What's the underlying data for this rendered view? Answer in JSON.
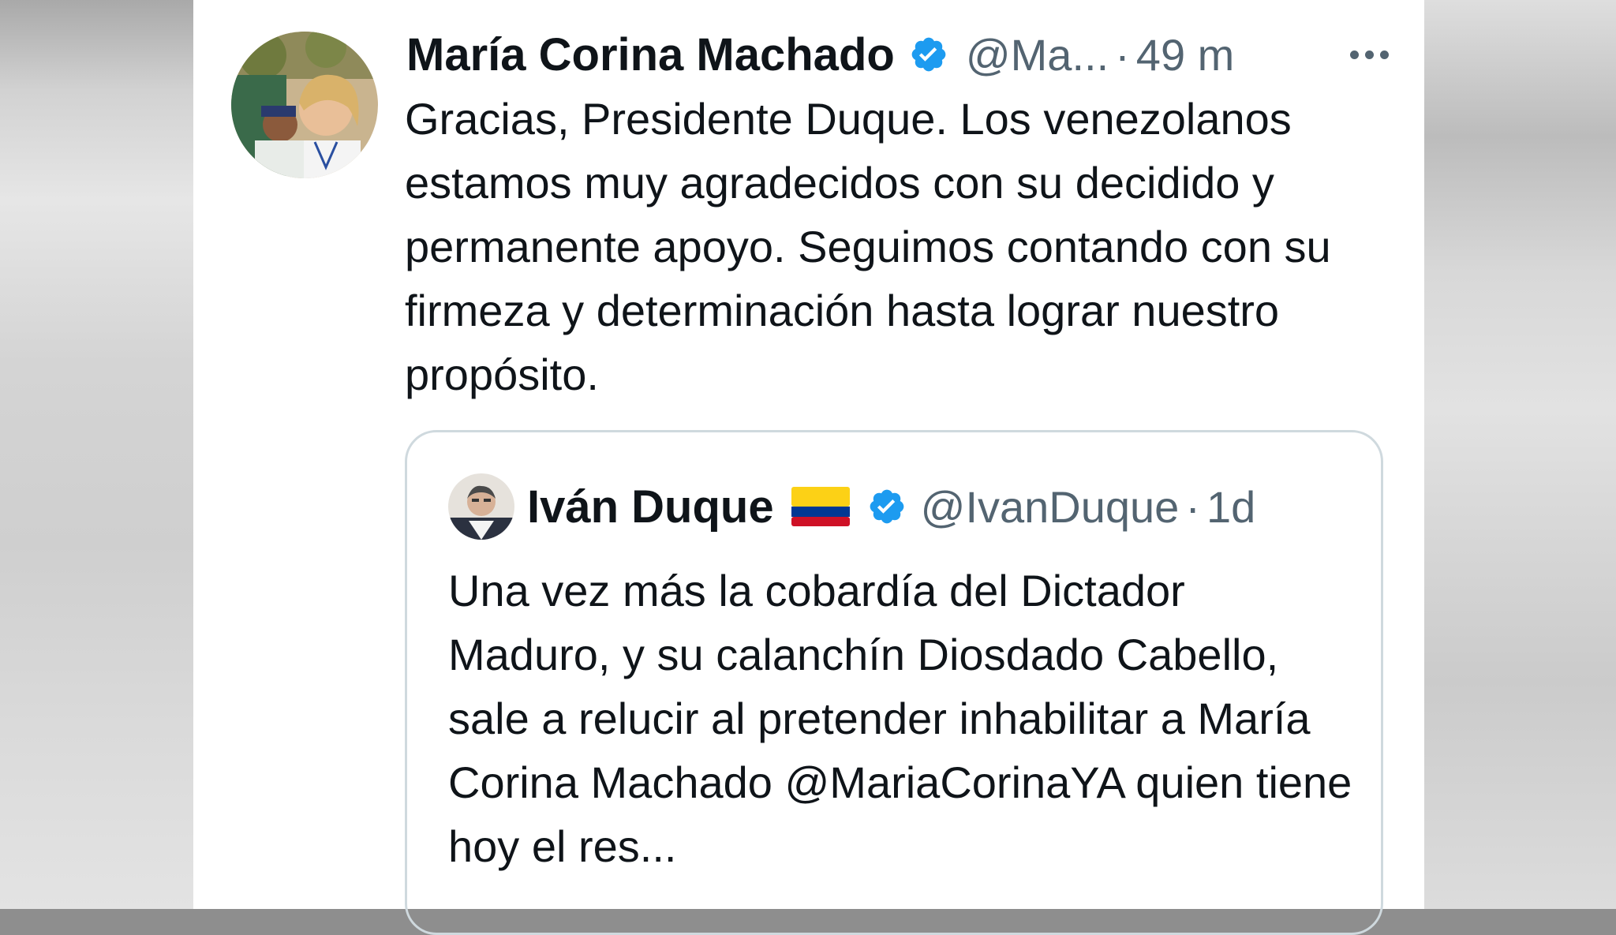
{
  "tweet": {
    "author_name": "María Corina Machado",
    "handle": "@Ma...",
    "separator": "·",
    "time": "49 m",
    "verified_icon": "verified-badge-icon",
    "more_icon": "more-options-icon",
    "text": "Gracias, Presidente Duque. Los venezolanos estamos muy agradecidos con su decidido y permanente apoyo. Seguimos contando con su firmeza y determinación hasta lograr nuestro propósito."
  },
  "quoted_tweet": {
    "author_name": "Iván Duque",
    "flag_icon": "colombia-flag-icon",
    "verified_icon": "verified-badge-icon",
    "handle": "@IvanDuque",
    "separator": "·",
    "time": "1d",
    "text": "Una vez más la cobardía del Dictador Maduro, y su calanchín Diosdado Cabello,  sale a relucir al pretender inhabilitar a María Corina Machado @MariaCorinaYA quien tiene hoy el res..."
  },
  "colors": {
    "text_primary": "#0f1419",
    "text_secondary": "#536471",
    "verified_blue": "#1d9bf0",
    "border": "#cfd9de",
    "flag_yellow": "#fcd116",
    "flag_blue": "#003893",
    "flag_red": "#ce1126"
  }
}
